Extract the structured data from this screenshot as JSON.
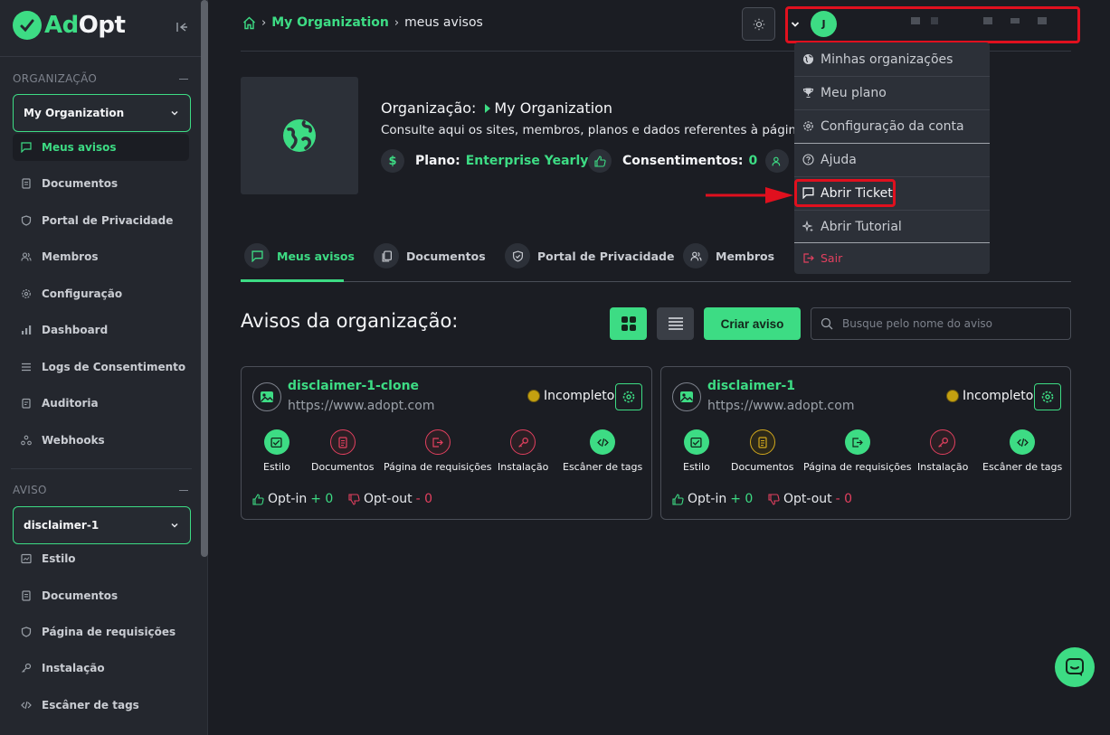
{
  "brand": {
    "ad": "Ad",
    "opt": "Opt"
  },
  "sidebar": {
    "org_section_label": "ORGANIZAÇÃO",
    "org_selector": "My Organization",
    "org_items": [
      {
        "label": "Meus avisos",
        "icon": "message-square-icon",
        "active": true
      },
      {
        "label": "Documentos",
        "icon": "file-text-icon"
      },
      {
        "label": "Portal de Privacidade",
        "icon": "shield-icon"
      },
      {
        "label": "Membros",
        "icon": "users-icon"
      },
      {
        "label": "Configuração",
        "icon": "gear-icon"
      },
      {
        "label": "Dashboard",
        "icon": "bar-chart-icon"
      },
      {
        "label": "Logs de Consentimento",
        "icon": "list-icon"
      },
      {
        "label": "Auditoria",
        "icon": "clipboard-icon"
      },
      {
        "label": "Webhooks",
        "icon": "webhook-icon"
      }
    ],
    "aviso_section_label": "AVISO",
    "aviso_selector": "disclaimer-1",
    "aviso_items": [
      {
        "label": "Estilo",
        "icon": "palette-icon"
      },
      {
        "label": "Documentos",
        "icon": "file-text-icon"
      },
      {
        "label": "Página de requisições",
        "icon": "shield-icon"
      },
      {
        "label": "Instalação",
        "icon": "key-icon"
      },
      {
        "label": "Escâner de tags",
        "icon": "code-icon"
      }
    ]
  },
  "breadcrumb": {
    "org": "My Organization",
    "current": "meus avisos"
  },
  "user": {
    "initial": "J"
  },
  "organization": {
    "label": "Organização:",
    "name": "My Organization",
    "description": "Consulte aqui os sites, membros, planos e dados referentes à página da organização",
    "plan_label": "Plano:",
    "plan_value": "Enterprise Yearly",
    "consents_label": "Consentimentos:",
    "consents_value": "0"
  },
  "tabs": [
    {
      "label": "Meus avisos",
      "icon": "message-square-icon",
      "active": true
    },
    {
      "label": "Documentos",
      "icon": "copy-icon"
    },
    {
      "label": "Portal de Privacidade",
      "icon": "shield-icon"
    },
    {
      "label": "Membros",
      "icon": "users-icon"
    }
  ],
  "avisos": {
    "title": "Avisos da organização:",
    "create_label": "Criar aviso",
    "search_placeholder": "Busque pelo nome do aviso"
  },
  "cards": [
    {
      "name": "disclaimer-1-clone",
      "url": "https://www.adopt.com",
      "status": "Incompleto",
      "actions": [
        "Estilo",
        "Documentos",
        "Página de requisições",
        "Instalação",
        "Escâner de tags"
      ],
      "optin_label": "Opt-in",
      "optin_value": "+ 0",
      "optout_label": "Opt-out",
      "optout_value": "- 0"
    },
    {
      "name": "disclaimer-1",
      "url": "https://www.adopt.com",
      "status": "Incompleto",
      "actions": [
        "Estilo",
        "Documentos",
        "Página de requisições",
        "Instalação",
        "Escâner de tags"
      ],
      "optin_label": "Opt-in",
      "optin_value": "+ 0",
      "optout_label": "Opt-out",
      "optout_value": "- 0"
    }
  ],
  "dropdown": [
    {
      "label": "Minhas organizações",
      "icon": "globe-icon"
    },
    {
      "label": "Meu plano",
      "icon": "trophy-icon"
    },
    {
      "label": "Configuração da conta",
      "icon": "gear-icon"
    },
    {
      "label": "Ajuda",
      "icon": "help-circle-icon"
    },
    {
      "label": "Abrir Ticket",
      "icon": "message-square-icon",
      "highlighted": true
    },
    {
      "label": "Abrir Tutorial",
      "icon": "sparkles-icon"
    },
    {
      "label": "Sair",
      "icon": "logout-icon"
    }
  ],
  "colors": {
    "accent": "#3ddc84",
    "danger": "#e2405f",
    "annotation": "#e0101e",
    "warning": "#c4a010",
    "background": "#1b1d23"
  }
}
